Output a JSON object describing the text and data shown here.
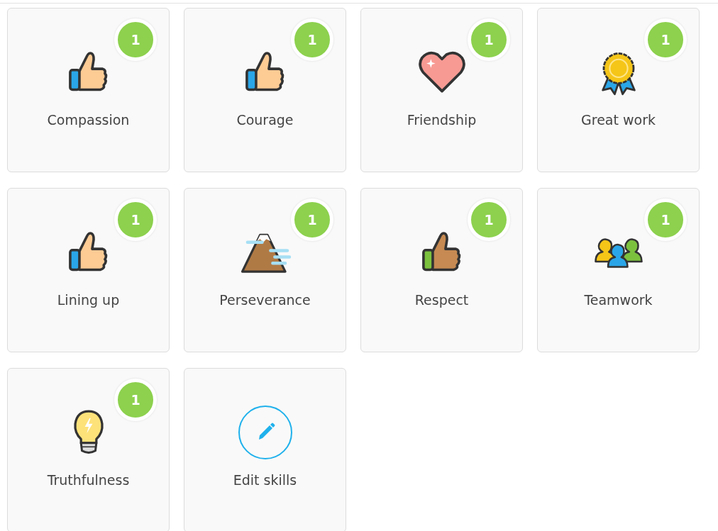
{
  "skills": [
    {
      "kind": "skill",
      "label": "Compassion",
      "count": "1"
    },
    {
      "kind": "skill",
      "label": "Courage",
      "count": "1"
    },
    {
      "kind": "skill",
      "label": "Friendship",
      "count": "1"
    },
    {
      "kind": "skill",
      "label": "Great work",
      "count": "1"
    },
    {
      "kind": "skill",
      "label": "Lining up",
      "count": "1"
    },
    {
      "kind": "skill",
      "label": "Perseverance",
      "count": "1"
    },
    {
      "kind": "skill",
      "label": "Respect",
      "count": "1"
    },
    {
      "kind": "skill",
      "label": "Teamwork",
      "count": "1"
    },
    {
      "kind": "skill",
      "label": "Truthfulness",
      "count": "1"
    },
    {
      "kind": "edit",
      "label": "Edit skills"
    }
  ]
}
